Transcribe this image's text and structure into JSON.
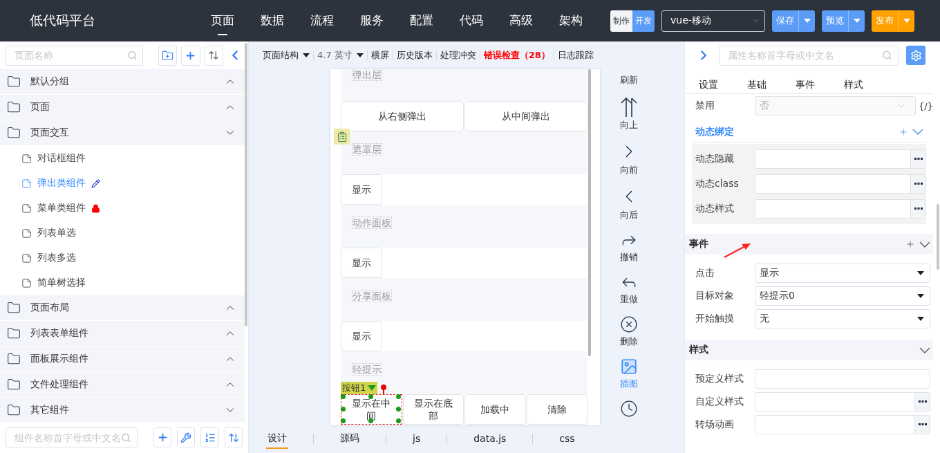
{
  "header": {
    "logo": "低代码平台",
    "nav": [
      {
        "label": "页面",
        "selected": true
      },
      {
        "label": "数据",
        "selected": false
      },
      {
        "label": "流程",
        "selected": false
      },
      {
        "label": "服务",
        "selected": false
      },
      {
        "label": "配置",
        "selected": false
      },
      {
        "label": "代码",
        "selected": false
      },
      {
        "label": "高级",
        "selected": false
      },
      {
        "label": "架构",
        "selected": false
      }
    ],
    "mode_toggle": [
      {
        "label": "制作",
        "selected": false
      },
      {
        "label": "开发",
        "selected": true
      }
    ],
    "template_select": {
      "value": "vue-移动"
    },
    "actions": [
      {
        "label": "保存",
        "color": "#5b9cf7"
      },
      {
        "label": "预览",
        "color": "#5b9cf7"
      },
      {
        "label": "发布",
        "color": "#ffa200"
      }
    ]
  },
  "left_panel": {
    "search": {
      "placeholder": "页面名称"
    },
    "groups": [
      {
        "label": "默认分组",
        "expanded": false
      },
      {
        "label": "页面",
        "expanded": false
      },
      {
        "label": "页面交互",
        "expanded": true,
        "children": [
          {
            "label": "对话框组件",
            "selected": false
          },
          {
            "label": "弹出类组件",
            "selected": true,
            "kind": "editing"
          },
          {
            "label": "菜单类组件",
            "selected": false,
            "kind": "locked"
          },
          {
            "label": "列表单选",
            "selected": false
          },
          {
            "label": "列表多选",
            "selected": false
          },
          {
            "label": "简单树选择",
            "selected": false
          }
        ]
      },
      {
        "label": "页面布局",
        "expanded": false
      },
      {
        "label": "列表表单组件",
        "expanded": false
      },
      {
        "label": "面板展示组件",
        "expanded": false
      },
      {
        "label": "文件处理组件",
        "expanded": false
      },
      {
        "label": "其它组件",
        "expanded": true
      }
    ],
    "component_search": {
      "placeholder": "组件名称首字母或中文名"
    }
  },
  "toolbar": {
    "items": [
      {
        "label": "页面结构",
        "dropdown": true,
        "kind": "normal"
      },
      {
        "label": "4.7 英寸",
        "dropdown": true,
        "kind": "muted"
      },
      {
        "label": "横屏",
        "dropdown": false,
        "kind": "normal"
      },
      {
        "label": "历史版本",
        "dropdown": false,
        "kind": "normal"
      },
      {
        "label": "处理冲突",
        "dropdown": false,
        "kind": "normal"
      },
      {
        "label": "错误检查（28）",
        "dropdown": false,
        "kind": "error"
      },
      {
        "label": "日志跟踪",
        "dropdown": false,
        "kind": "normal"
      }
    ]
  },
  "canvas": {
    "sections": [
      {
        "title": "弹出层",
        "buttons": [
          {
            "label": "从右侧弹出",
            "selected": false
          },
          {
            "label": "从中间弹出",
            "selected": false
          }
        ]
      },
      {
        "title": "遮罩层",
        "buttons": [
          {
            "label": "显示",
            "selected": false
          }
        ]
      },
      {
        "title": "动作面板",
        "buttons": [
          {
            "label": "显示",
            "selected": false
          }
        ]
      },
      {
        "title": "分享面板",
        "buttons": [
          {
            "label": "显示",
            "selected": false
          }
        ]
      },
      {
        "title": "轻提示",
        "buttons": [
          {
            "label": "显示在中间",
            "selected": true,
            "tag": "按钮1"
          },
          {
            "label": "显示在底部",
            "selected": false
          },
          {
            "label": "加载中",
            "selected": false
          },
          {
            "label": "清除",
            "selected": false
          }
        ]
      }
    ]
  },
  "tools": [
    {
      "label": "刷新",
      "kind": "refresh",
      "selected": false
    },
    {
      "label": "向上",
      "kind": "up",
      "selected": false
    },
    {
      "label": "向前",
      "kind": "forward",
      "selected": false
    },
    {
      "label": "向后",
      "kind": "back",
      "selected": false
    },
    {
      "label": "撤销",
      "kind": "undo",
      "selected": false
    },
    {
      "label": "重做",
      "kind": "redo",
      "selected": false
    },
    {
      "label": "删除",
      "kind": "delete",
      "selected": false
    },
    {
      "label": "插图",
      "kind": "image",
      "selected": true
    },
    {
      "kind": "clock",
      "selected": false
    }
  ],
  "bottom_tabs": [
    {
      "label": "设计",
      "selected": true
    },
    {
      "label": "源码",
      "selected": false
    },
    {
      "label": "js",
      "selected": false
    },
    {
      "label": "data.js",
      "selected": false
    },
    {
      "label": "css",
      "selected": false
    }
  ],
  "right_panel": {
    "search": {
      "placeholder": "属性名称首字母或中文名"
    },
    "tabs": [
      {
        "label": "设置"
      },
      {
        "label": "基础"
      },
      {
        "label": "事件"
      },
      {
        "label": "样式"
      }
    ],
    "disabled_row": {
      "label": "禁用",
      "value": "否",
      "code_toggle": "{/}"
    },
    "sections": [
      {
        "title": "动态绑定",
        "kind": "binding",
        "expanded": true,
        "addable": true,
        "rows": [
          {
            "label": "动态隐藏",
            "kind": "input_more"
          },
          {
            "label": "动态class",
            "kind": "input_more"
          },
          {
            "label": "动态样式",
            "kind": "input_more"
          }
        ]
      },
      {
        "title": "事件",
        "kind": "panel",
        "expanded": true,
        "addable": true,
        "rows": [
          {
            "label": "点击",
            "kind": "select",
            "value": "显示"
          },
          {
            "label": "目标对象",
            "kind": "select",
            "value": "轻提示0"
          },
          {
            "label": "开始触摸",
            "kind": "select",
            "value": "无"
          }
        ]
      },
      {
        "title": "样式",
        "kind": "panel",
        "expanded": true,
        "addable": false,
        "rows": [
          {
            "label": "预定义样式",
            "kind": "input"
          },
          {
            "label": "自定义样式",
            "kind": "input_more"
          },
          {
            "label": "转场动画",
            "kind": "input_more"
          }
        ]
      }
    ]
  }
}
